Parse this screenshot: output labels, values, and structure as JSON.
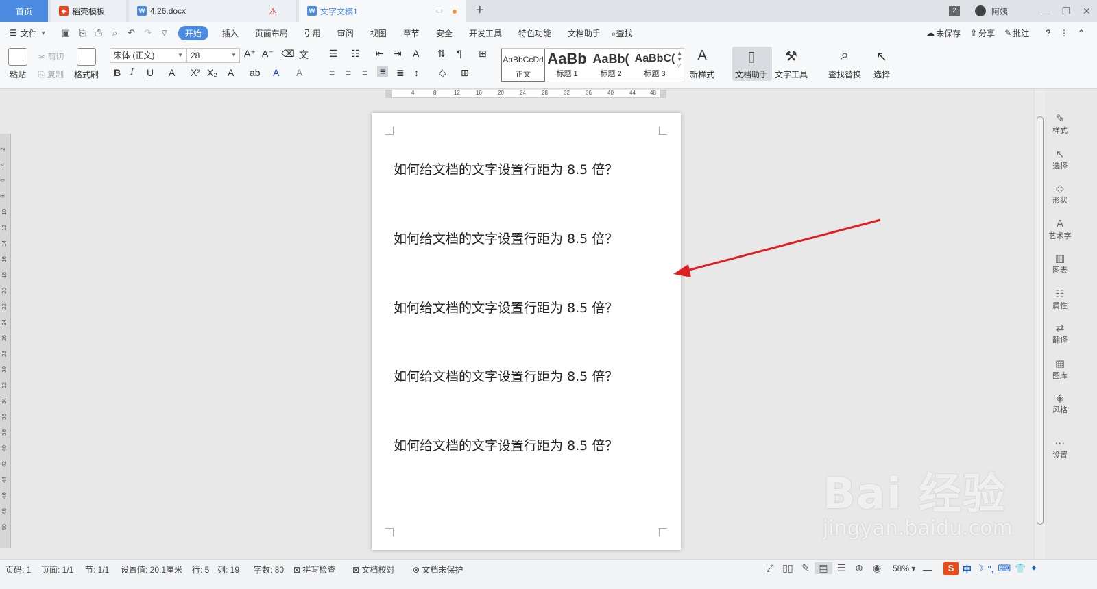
{
  "tabs": {
    "home": "首页",
    "daoke": "稻壳模板",
    "doc1": "4.26.docx",
    "doc2": "文字文稿1"
  },
  "titlebar": {
    "window_count": "2",
    "username": "阿姨"
  },
  "menu": {
    "file": "文件",
    "items": [
      "开始",
      "插入",
      "页面布局",
      "引用",
      "审阅",
      "视图",
      "章节",
      "安全",
      "开发工具",
      "特色功能",
      "文档助手"
    ],
    "search": "查找",
    "right": [
      "未保存",
      "分享",
      "批注"
    ]
  },
  "ribbon": {
    "paste": "粘贴",
    "cut": "剪切",
    "copy": "复制",
    "format_painter": "格式刷",
    "font_name": "宋体 (正文)",
    "font_size": "28",
    "styles": [
      {
        "preview": "AaBbCcDd",
        "name": "正文"
      },
      {
        "preview": "AaBb",
        "name": "标题 1"
      },
      {
        "preview": "AaBb(",
        "name": "标题 2"
      },
      {
        "preview": "AaBbC(",
        "name": "标题 3"
      }
    ],
    "new_style": "新样式",
    "doc_helper": "文档助手",
    "text_tools": "文字工具",
    "find_replace": "查找替换",
    "select": "选择"
  },
  "ruler": {
    "h_ticks": [
      "4",
      "8",
      "12",
      "16",
      "20",
      "24",
      "28",
      "32",
      "36",
      "40",
      "44",
      "48"
    ],
    "v_ticks": [
      "2",
      "4",
      "6",
      "8",
      "10",
      "12",
      "14",
      "16",
      "18",
      "20",
      "22",
      "24",
      "26",
      "28",
      "30",
      "32",
      "34",
      "36",
      "38",
      "40",
      "42",
      "44",
      "46",
      "48",
      "50"
    ]
  },
  "document": {
    "paragraphs": [
      "如何给文档的文字设置行距为 8.5 倍？",
      "如何给文档的文字设置行距为 8.5 倍？",
      "如何给文档的文字设置行距为 8.5 倍？",
      "如何给文档的文字设置行距为 8.5 倍？",
      "如何给文档的文字设置行距为 8.5 倍？"
    ]
  },
  "right_panel": [
    "样式",
    "选择",
    "形状",
    "艺术字",
    "图表",
    "属性",
    "翻译",
    "图库",
    "风格",
    "设置"
  ],
  "status": {
    "page_no": "页码: 1",
    "pages": "页面: 1/1",
    "section": "节: 1/1",
    "setting": "设置值: 20.1厘米",
    "row": "行: 5",
    "col": "列: 19",
    "words": "字数: 80",
    "spell": "拼写检查",
    "proof": "文档校对",
    "protect": "文档未保护",
    "zoom": "58%"
  },
  "ime": {
    "lang": "中"
  },
  "watermark": {
    "main": "Bai 经验",
    "sub": "jingyan.baidu.com"
  },
  "colors": {
    "accent": "#4a8ae0",
    "arrow": "#e02020"
  }
}
